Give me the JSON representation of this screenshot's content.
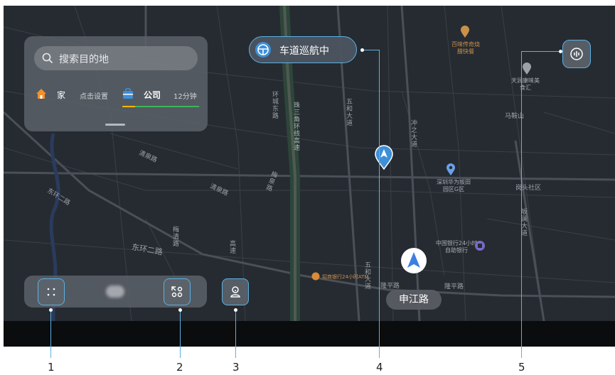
{
  "search_card": {
    "placeholder": "搜索目的地",
    "home_label": "家",
    "home_hint": "点击设置",
    "company_label": "公司",
    "company_eta": "12分钟"
  },
  "nav_pill": {
    "label": "车道巡航中"
  },
  "current_road": "申江路",
  "map_labels": {
    "road_dh2": "东环二路",
    "road_dh2b": "东环二路",
    "road_wh": "五和大道",
    "road_wh2": "五和大道",
    "road_cz": "冲之大道",
    "road_lp": "隆平路",
    "road_lp2": "隆平路",
    "road_qq": "清泉路",
    "road_qq2": "清泉路",
    "road_mq": "梅泉路",
    "road_vert1": "环城东路",
    "road_vert2": "梅清路",
    "road_vert3": "高速",
    "expressway": "珠三角环线高速",
    "mcmcomplex": "马鞍山",
    "gtshq": "岗头社区",
    "huawei": "深圳华为坂田园区G区",
    "restaurant1": "百味传奇烧腊快餐",
    "restaurant2": "天润康味美食汇",
    "bank": "中国银行24小时自助银行",
    "atm": "招商银行24小时ATM",
    "road_vert4": "坂澜大道"
  },
  "callouts": [
    "1",
    "2",
    "3",
    "4",
    "5"
  ],
  "colors": {
    "accent": "#5bb1e4",
    "map_bg": "#262b31",
    "panel": "#5c6168"
  },
  "icons": {
    "apps": "apps-icon",
    "collapse": "collapse-grid-icon",
    "nav_person": "navigation-profile-icon",
    "voice": "voice-assistant-icon",
    "steering": "steering-wheel-icon"
  }
}
